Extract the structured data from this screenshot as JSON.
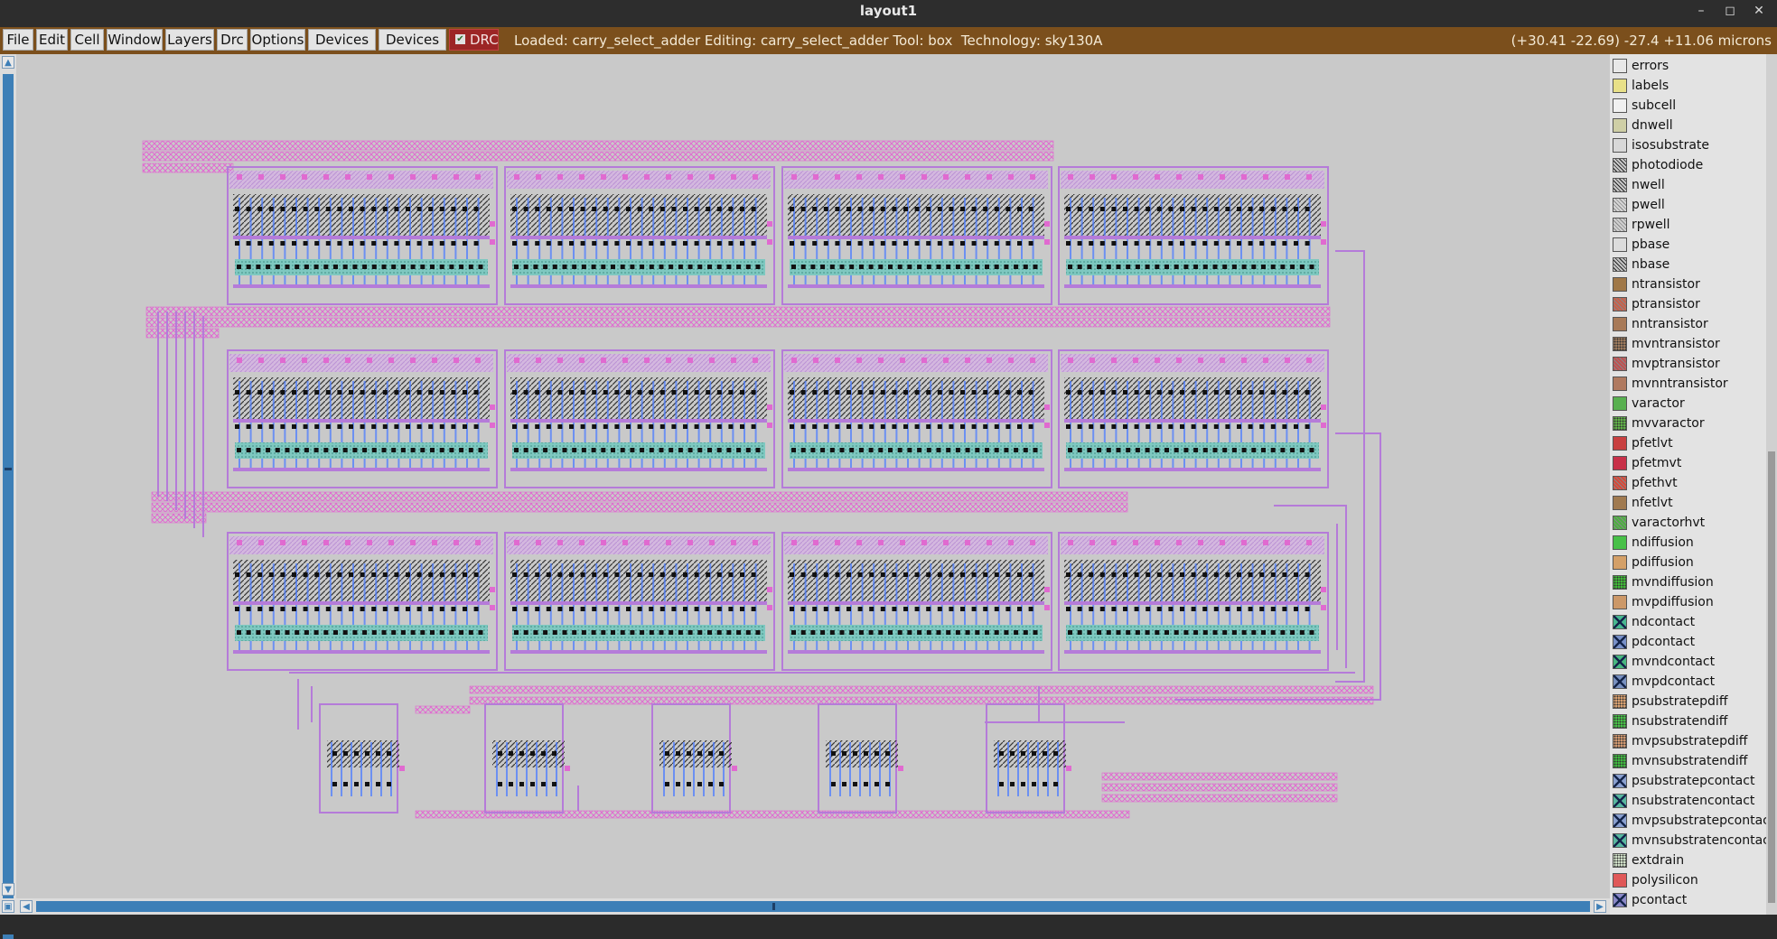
{
  "window": {
    "title": "layout1",
    "controls": [
      "minimize-icon",
      "maximize-icon",
      "close-icon"
    ]
  },
  "menu": {
    "items": [
      "File",
      "Edit",
      "Cell",
      "Window",
      "Layers",
      "Drc",
      "Options",
      "Devices 1",
      "Devices 2"
    ],
    "drc_label": "DRC",
    "drc_checked": true
  },
  "status": {
    "text": "Loaded: carry_select_adder Editing: carry_select_adder Tool: box  Technology: sky130A",
    "coords": "(+30.41 -22.69) -27.4 +11.06 microns"
  },
  "colors": {
    "menubar_bg": "#7b4f1c",
    "canvas_bg": "#c9c9c9",
    "drc_bg": "#9c2525",
    "metal1": "#b57bd9",
    "metal2": "#e06ad0",
    "poly": "#4c7cff",
    "ndiff": "#39b36a",
    "contact": "#111111"
  },
  "layout_view": {
    "cell": "carry_select_adder",
    "block_rows": 3,
    "blocks_per_row": 4,
    "mux_cells": 5
  },
  "layers": [
    {
      "name": "errors",
      "color": "#e8e8e8",
      "pattern": "none"
    },
    {
      "name": "labels",
      "color": "#e8e088",
      "pattern": "none"
    },
    {
      "name": "subcell",
      "color": "#f0f0f0",
      "pattern": "none"
    },
    {
      "name": "dnwell",
      "color": "#cfcfa6",
      "pattern": "none"
    },
    {
      "name": "isosubstrate",
      "color": "#d8d8d8",
      "pattern": "none"
    },
    {
      "name": "photodiode",
      "color": "#c8c8c8",
      "pattern": "diag"
    },
    {
      "name": "nwell",
      "color": "#c8c8c8",
      "pattern": "diag"
    },
    {
      "name": "pwell",
      "color": "#d6d6d6",
      "pattern": "diagl"
    },
    {
      "name": "rpwell",
      "color": "#d0d0d0",
      "pattern": "diagl"
    },
    {
      "name": "pbase",
      "color": "#dcdcdc",
      "pattern": "none"
    },
    {
      "name": "nbase",
      "color": "#c4c4c4",
      "pattern": "diag"
    },
    {
      "name": "ntransistor",
      "color": "#a07848",
      "pattern": "none"
    },
    {
      "name": "ptransistor",
      "color": "#c8604a",
      "pattern": "diagl"
    },
    {
      "name": "nntransistor",
      "color": "#a87a58",
      "pattern": "none"
    },
    {
      "name": "mvntransistor",
      "color": "#9c7a5c",
      "pattern": "dots"
    },
    {
      "name": "mvptransistor",
      "color": "#c05050",
      "pattern": "diagl"
    },
    {
      "name": "mvnntransistor",
      "color": "#b07a60",
      "pattern": "none"
    },
    {
      "name": "varactor",
      "color": "#58b050",
      "pattern": "none"
    },
    {
      "name": "mvvaractor",
      "color": "#60b048",
      "pattern": "dots"
    },
    {
      "name": "pfetlvt",
      "color": "#c84040",
      "pattern": "none"
    },
    {
      "name": "pfetmvt",
      "color": "#c83048",
      "pattern": "none"
    },
    {
      "name": "pfethvt",
      "color": "#d84838",
      "pattern": "diagl"
    },
    {
      "name": "nfetlvt",
      "color": "#a07a50",
      "pattern": "none"
    },
    {
      "name": "varactorhvt",
      "color": "#4cb040",
      "pattern": "diagl"
    },
    {
      "name": "ndiffusion",
      "color": "#48c048",
      "pattern": "none"
    },
    {
      "name": "pdiffusion",
      "color": "#d4a068",
      "pattern": "none"
    },
    {
      "name": "mvndiffusion",
      "color": "#40b838",
      "pattern": "dots"
    },
    {
      "name": "mvpdiffusion",
      "color": "#cc9868",
      "pattern": "none"
    },
    {
      "name": "ndcontact",
      "color": "#48b890",
      "pattern": "cross"
    },
    {
      "name": "pdcontact",
      "color": "#7890c8",
      "pattern": "cross"
    },
    {
      "name": "mvndcontact",
      "color": "#48b880",
      "pattern": "cross"
    },
    {
      "name": "mvpdcontact",
      "color": "#7890c0",
      "pattern": "cross"
    },
    {
      "name": "psubstratepdiff",
      "color": "#d8a070",
      "pattern": "dots"
    },
    {
      "name": "nsubstratendiff",
      "color": "#48c048",
      "pattern": "dots"
    },
    {
      "name": "mvpsubstratepdiff",
      "color": "#d09870",
      "pattern": "dots"
    },
    {
      "name": "mvnsubstratendiff",
      "color": "#40b840",
      "pattern": "dots"
    },
    {
      "name": "psubstratepcontact",
      "color": "#8aa0d0",
      "pattern": "cross"
    },
    {
      "name": "nsubstratencontact",
      "color": "#58b8a0",
      "pattern": "cross"
    },
    {
      "name": "mvpsubstratepcontact",
      "color": "#8aa0d0",
      "pattern": "cross"
    },
    {
      "name": "mvnsubstratencontact",
      "color": "#58b8a0",
      "pattern": "cross"
    },
    {
      "name": "extdrain",
      "color": "#d0e0c8",
      "pattern": "dots"
    },
    {
      "name": "polysilicon",
      "color": "#e05858",
      "pattern": "none"
    },
    {
      "name": "pcontact",
      "color": "#8a88c8",
      "pattern": "cross"
    }
  ]
}
